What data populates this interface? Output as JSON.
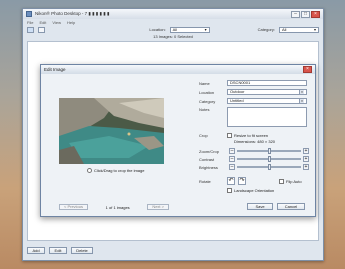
{
  "app": {
    "title": "Nikon® Photo Desktop - 7 ▮ ▮ ▮ ▮ ▮ ▮",
    "menu": [
      "File",
      "Edit",
      "View",
      "Help"
    ],
    "toolbar": {
      "location_label": "Location:",
      "location_value": "All",
      "category_label": "Category:",
      "category_value": "All"
    },
    "status": "13 Images: 0 Selected",
    "buttons": {
      "add": "Add",
      "edit": "Edit",
      "delete": "Delete"
    }
  },
  "dialog": {
    "title": "Edit Image",
    "close": "×",
    "name_label": "Name",
    "name_value": "DSCN0001",
    "location_label": "Location",
    "location_value": "Outdoor",
    "category_label": "Category",
    "category_value": "Untitled",
    "notes_label": "Notes",
    "crop_label": "Crop",
    "crop_option": "Resize to fit screen",
    "crop_dims": "Dimensions: 480 × 320",
    "zoom_label": "Zoom/Crop",
    "contrast_label": "Contrast",
    "brightness_label": "Brightness",
    "rotate_label": "Rotate",
    "flip_label": "Flip Auto",
    "landscape_label": "Landscape Orientation",
    "crop_hint": "Click/Drag to crop the image",
    "prev": "< Previous",
    "counter": "1 of 1 images",
    "next": "Next >",
    "save": "Save",
    "cancel": "Cancel"
  },
  "sliders": {
    "zoom": 0.5,
    "contrast": 0.5,
    "brightness": 0.5
  },
  "colors": {
    "accent": "#4a74b0",
    "close": "#d8544b"
  }
}
